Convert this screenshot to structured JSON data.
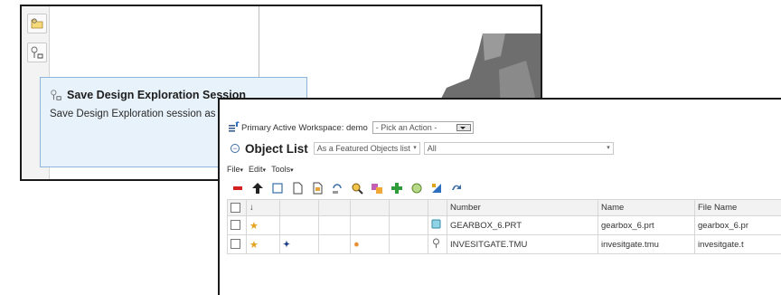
{
  "tooltip": {
    "title": "Save Design Exploration Session",
    "description": "Save Design Exploration session as a *.tmu file."
  },
  "workspace": {
    "label": "Primary Active Workspace: demo",
    "action_select": "- Pick an Action -"
  },
  "object_list": {
    "title": "Object List",
    "view_select": "As a Featured Objects list",
    "filter_select": "All"
  },
  "menus": [
    "File",
    "Edit",
    "Tools"
  ],
  "table": {
    "columns": [
      "Number",
      "Name",
      "File Name"
    ],
    "rows": [
      {
        "number": "GEARBOX_6.PRT",
        "name": "gearbox_6.prt",
        "file_name": "gearbox_6.pr"
      },
      {
        "number": "INVESITGATE.TMU",
        "name": "invesitgate.tmu",
        "file_name": "invesitgate.t"
      }
    ]
  },
  "colors": {
    "tooltip_bg": "#e8f2fb",
    "tooltip_border": "#8fb6da",
    "star": "#e3a21a",
    "remove": "#d42020"
  }
}
